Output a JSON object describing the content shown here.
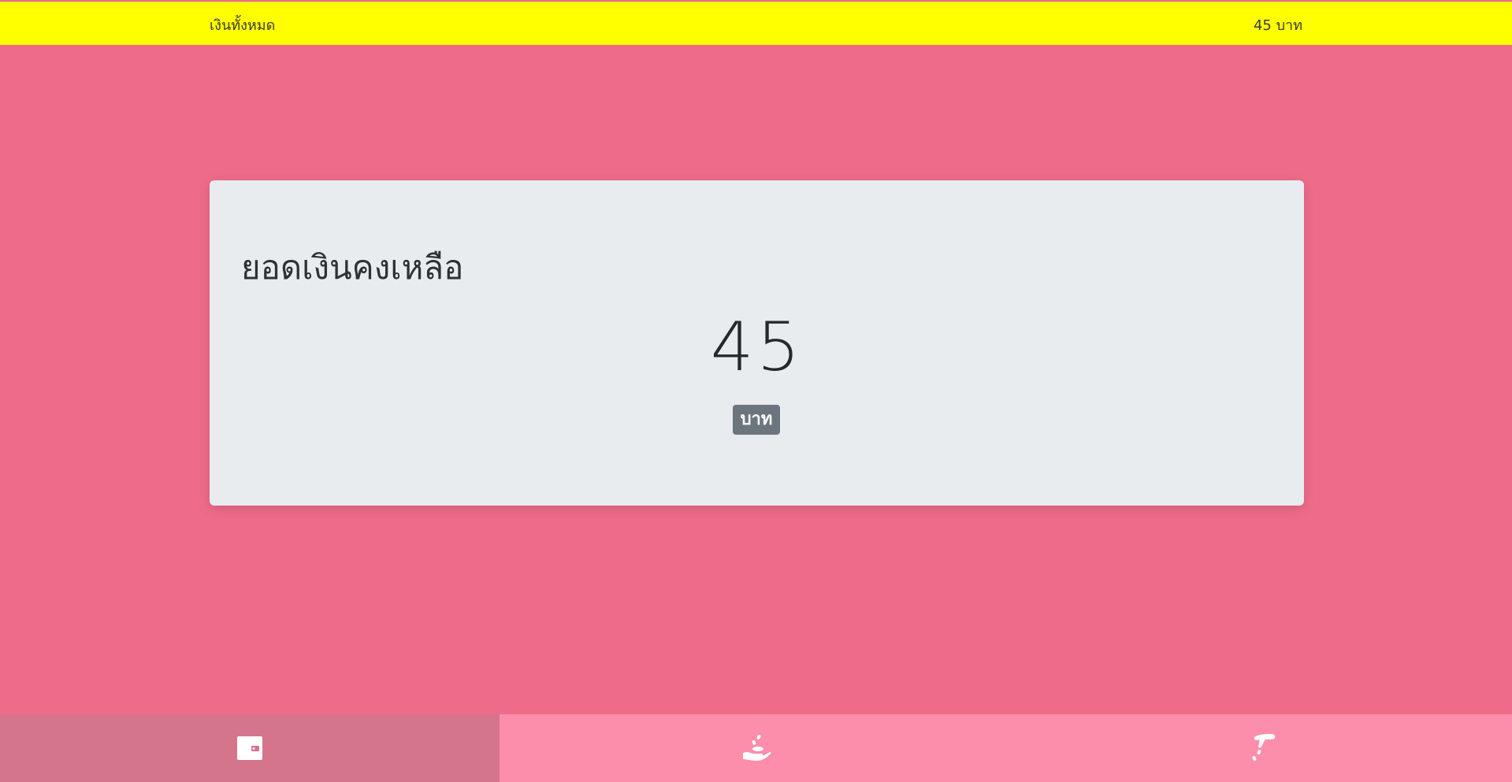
{
  "header": {
    "label": "เงินทั้งหมด",
    "total": "45 บาท"
  },
  "balance_card": {
    "title": "ยอดเงินคงเหลือ",
    "amount": "45",
    "unit": "บาท"
  },
  "bottom_nav": {
    "items": [
      {
        "icon": "wallet-icon",
        "active": true
      },
      {
        "icon": "hand-receive-icon",
        "active": false
      },
      {
        "icon": "hand-give-icon",
        "active": false
      }
    ]
  },
  "colors": {
    "background": "#ee6c89",
    "header": "#ffff00",
    "card": "#e8ecef",
    "badge": "#6c757d",
    "nav": "#fc8eab",
    "nav_active": "#d5758b"
  }
}
